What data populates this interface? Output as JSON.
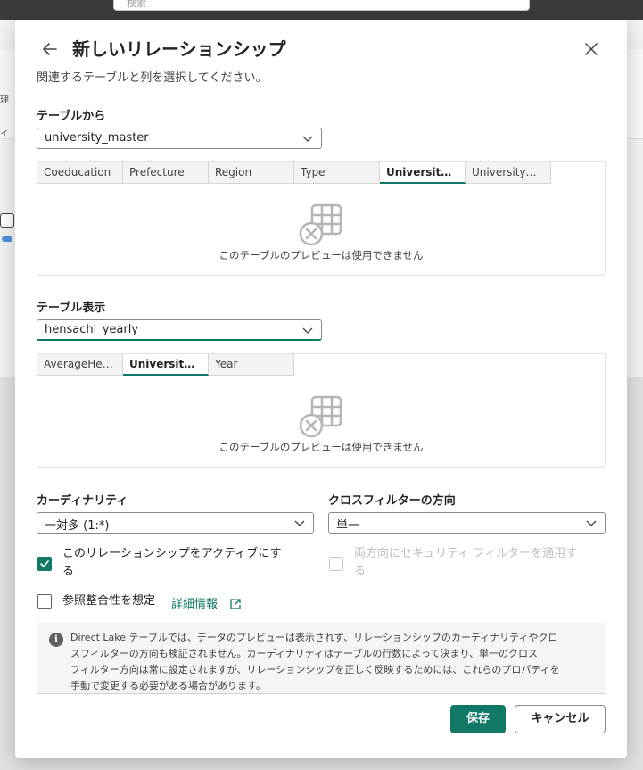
{
  "background": {
    "search_placeholder": "検索",
    "side_text_1": "理",
    "side_text_2": "ィ"
  },
  "dialog": {
    "title": "新しいリレーションシップ",
    "subtitle": "関連するテーブルと列を選択してください。",
    "from_table": {
      "label": "テーブルから",
      "selected": "university_master",
      "columns": [
        "Coeducation",
        "Prefecture",
        "Region",
        "Type",
        "UniversityID",
        "UniversityNa..."
      ],
      "active_column": "UniversityID",
      "empty_message": "このテーブルのプレビューは使用できません"
    },
    "to_table": {
      "label": "テーブル表示",
      "selected": "hensachi_yearly",
      "columns": [
        "AverageHens...",
        "UniversityID",
        "Year"
      ],
      "active_column": "UniversityID",
      "empty_message": "このテーブルのプレビューは使用できません"
    },
    "cardinality": {
      "label": "カーディナリティ",
      "selected": "一対多 (1:*)"
    },
    "cross_filter": {
      "label": "クロスフィルターの方向",
      "selected": "単一"
    },
    "active_checkbox": {
      "label_line1": "このリレーションシップをアクティブにす",
      "label_line2": "る",
      "checked": true
    },
    "security_checkbox": {
      "label_line1": "両方向にセキュリティ フィルターを適用す",
      "label_line2": "る",
      "checked": false,
      "disabled": true
    },
    "integrity_checkbox": {
      "label": "参照整合性を想定",
      "checked": false
    },
    "details_link": "詳細情報",
    "info": {
      "icon": "i",
      "line1": "Direct Lake テーブルでは、データのプレビューは表示されず、リレーションシップのカーディナリティやクロ",
      "line2": "スフィルターの方向も検証されません。カーディナリティはテーブルの行数によって決まり、単一のクロス",
      "line3": "フィルター方向は常に設定されますが、リレーションシップを正しく反映するためには、これらのプロパティを",
      "line4": "手動で変更する必要がある場合があります。"
    },
    "save_label": "保存",
    "cancel_label": "キャンセル",
    "accent_color": "#117865"
  }
}
